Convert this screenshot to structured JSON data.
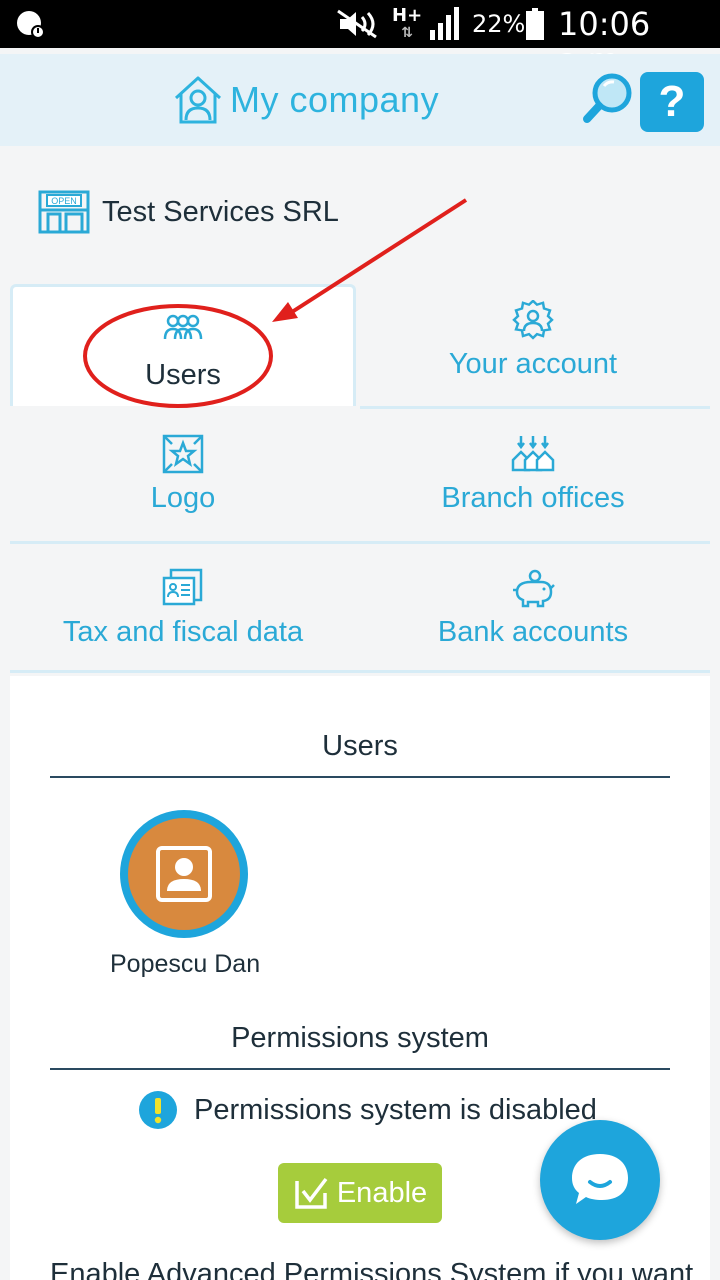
{
  "status_bar": {
    "network": "H+",
    "battery_percent": "22%",
    "time": "10:06 a.m."
  },
  "header": {
    "title": "My company",
    "help_label": "?"
  },
  "company": {
    "name": "Test Services SRL",
    "sign_text": "OPEN"
  },
  "tabs": [
    {
      "label": "Users",
      "icon": "users-group-icon",
      "active": true
    },
    {
      "label": "Your account",
      "icon": "user-gear-icon",
      "active": false
    },
    {
      "label": "Logo",
      "icon": "star-frame-icon",
      "active": false
    },
    {
      "label": "Branch offices",
      "icon": "branch-houses-icon",
      "active": false
    },
    {
      "label": "Tax and fiscal data",
      "icon": "fiscal-document-icon",
      "active": false
    },
    {
      "label": "Bank accounts",
      "icon": "piggy-bank-icon",
      "active": false
    }
  ],
  "users_section": {
    "title": "Users",
    "users": [
      {
        "name": "Popescu Dan"
      }
    ]
  },
  "permissions_section": {
    "title": "Permissions system",
    "status_text": "Permissions system is disabled",
    "enable_label": "Enable",
    "description": "Enable Advanced Permissions System if you want"
  },
  "colors": {
    "accent": "#1ea5dc",
    "enable_green": "#a6cc3c",
    "avatar_orange": "#d8893e",
    "annotation_red": "#e0201c"
  }
}
